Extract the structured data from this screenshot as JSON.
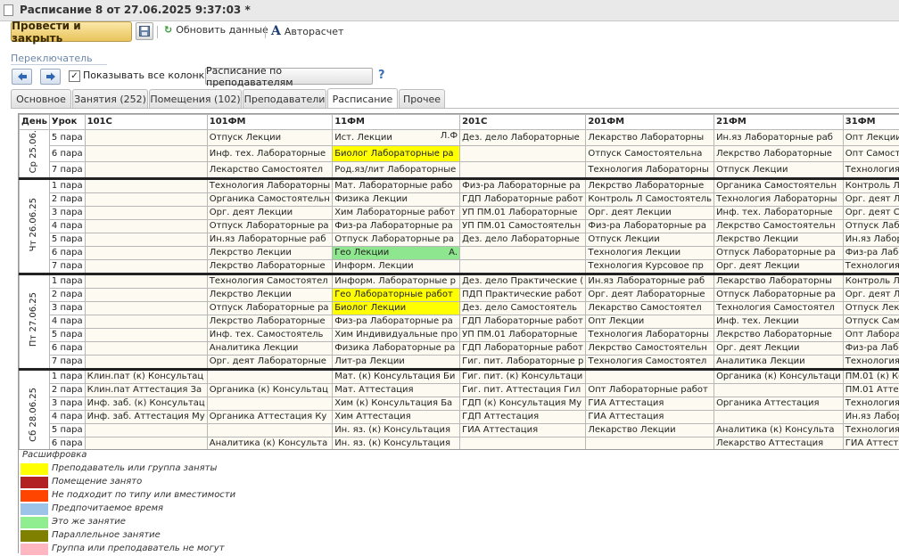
{
  "window": {
    "title": "Расписание 8 от 27.06.2025 9:37:03 *"
  },
  "toolbar": {
    "post_close": "Провести и закрыть",
    "refresh": "Обновить данные",
    "autocalc": "Авторасчет"
  },
  "switcher": {
    "label": "Переключатель",
    "show_all_columns": "Показывать все колонки",
    "show_all_checked": true,
    "by_teachers": "Расписание по преподавателям",
    "help": "?"
  },
  "tabs": [
    "Основное",
    "Занятия (252)",
    "Помещения (102)",
    "Преподаватели",
    "Расписание",
    "Прочее"
  ],
  "active_tab": "Расписание",
  "grid": {
    "headers": [
      "День",
      "Урок",
      "101С",
      "101ФМ",
      "11ФМ",
      "201С",
      "201ФМ",
      "21ФМ",
      "31ФМ"
    ],
    "days": [
      {
        "label": "Ср 25.06.",
        "rows": [
          {
            "lesson": "5 пара",
            "cells": [
              {
                "t": ""
              },
              {
                "t": "Отпуск Лекции"
              },
              {
                "t": "Ист. Лекции",
                "r": "Л.Ф"
              },
              {
                "t": "Дез. дело Лабораторные"
              },
              {
                "t": "Лекарство Лабораторны"
              },
              {
                "t": "Ин.яз Лабораторные раб"
              },
              {
                "t": "Опт Лекции",
                "r": "А.Х."
              }
            ]
          },
          {
            "lesson": "6 пара",
            "cells": [
              {
                "t": ""
              },
              {
                "t": "Инф. тех. Лабораторные"
              },
              {
                "t": "Биолог Лабораторные ра",
                "c": "y"
              },
              {
                "t": ""
              },
              {
                "t": "Отпуск Самостоятельна"
              },
              {
                "t": "Лекрство Лабораторные"
              },
              {
                "t": "Опт Самостоятельная на"
              }
            ]
          },
          {
            "lesson": "7 пара",
            "cells": [
              {
                "t": ""
              },
              {
                "t": "Лекарство Самостоятел"
              },
              {
                "t": "Род.яз/лит Лабораторные"
              },
              {
                "t": ""
              },
              {
                "t": "Технология Лабораторны"
              },
              {
                "t": "Отпуск Лекции"
              },
              {
                "t": "Технология Лекции"
              }
            ]
          }
        ]
      },
      {
        "label": "Чт 26.06.25",
        "rows": [
          {
            "lesson": "1 пара",
            "cells": [
              {
                "t": ""
              },
              {
                "t": "Технология Лабораторны"
              },
              {
                "t": "Мат. Лабораторные рабо"
              },
              {
                "t": "Физ-ра Лабораторные ра"
              },
              {
                "t": "Лекрство Лабораторные"
              },
              {
                "t": "Органика Самостоятельн"
              },
              {
                "t": "Контроль Л Лабораторны"
              }
            ]
          },
          {
            "lesson": "2 пара",
            "cells": [
              {
                "t": ""
              },
              {
                "t": "Органика Самостоятельн"
              },
              {
                "t": "Физика Лекции"
              },
              {
                "t": "ГДП Лабораторные работ"
              },
              {
                "t": "Контроль Л Самостоятель"
              },
              {
                "t": "Технология Лабораторны"
              },
              {
                "t": "Орг. деят Лекции"
              }
            ]
          },
          {
            "lesson": "3 пара",
            "cells": [
              {
                "t": ""
              },
              {
                "t": "Орг. деят Лекции"
              },
              {
                "t": "Хим Лабораторные работ"
              },
              {
                "t": "УП ПМ.01 Лабораторные"
              },
              {
                "t": "Орг. деят Лекции"
              },
              {
                "t": "Инф. тех. Лабораторные"
              },
              {
                "t": "Орг. деят Самостоятель"
              }
            ]
          },
          {
            "lesson": "4 пара",
            "cells": [
              {
                "t": ""
              },
              {
                "t": "Отпуск Лабораторные ра"
              },
              {
                "t": "Физ-ра Лабораторные ра"
              },
              {
                "t": "УП ПМ.01 Самостоятельн"
              },
              {
                "t": "Физ-ра Лабораторные ра"
              },
              {
                "t": "Лекрство Самостоятельн"
              },
              {
                "t": "Отпуск Лабораторные ра"
              }
            ]
          },
          {
            "lesson": "5 пара",
            "cells": [
              {
                "t": ""
              },
              {
                "t": "Ин.яз Лабораторные раб"
              },
              {
                "t": "Отпуск Лабораторные ра"
              },
              {
                "t": "Дез. дело Лабораторные"
              },
              {
                "t": "Отпуск Лекции"
              },
              {
                "t": "Лекрство Лекции"
              },
              {
                "t": "Ин.яз Лабораторные раб"
              }
            ]
          },
          {
            "lesson": "6 пара",
            "cells": [
              {
                "t": ""
              },
              {
                "t": "Лекрство Лекции"
              },
              {
                "t": "Гео Лекции",
                "r": "А.",
                "c": "g"
              },
              {
                "t": ""
              },
              {
                "t": "Технология Лекции"
              },
              {
                "t": "Отпуск Лабораторные ра"
              },
              {
                "t": "Физ-ра Лабораторные ра"
              }
            ]
          },
          {
            "lesson": "7 пара",
            "cells": [
              {
                "t": ""
              },
              {
                "t": "Лекрство Лабораторные"
              },
              {
                "t": "Информ. Лекции"
              },
              {
                "t": ""
              },
              {
                "t": "Технология Курсовое пр"
              },
              {
                "t": "Орг. деят Лекции"
              },
              {
                "t": "Технология Лабораторны"
              }
            ]
          }
        ]
      },
      {
        "label": "Пт 27.06.25",
        "rows": [
          {
            "lesson": "1 пара",
            "cells": [
              {
                "t": ""
              },
              {
                "t": "Технология Самостоятел"
              },
              {
                "t": "Информ. Лабораторные р"
              },
              {
                "t": "Дез. дело Практические ("
              },
              {
                "t": "Ин.яз Лабораторные раб"
              },
              {
                "t": "Лекарство Лабораторны"
              },
              {
                "t": "Контроль Л Лабораторны"
              }
            ]
          },
          {
            "lesson": "2 пара",
            "cells": [
              {
                "t": ""
              },
              {
                "t": "Лекрство Лекции"
              },
              {
                "t": "Гео Лабораторные работ",
                "c": "y"
              },
              {
                "t": "ПДП Практические работ"
              },
              {
                "t": "Орг. деят Лабораторные"
              },
              {
                "t": "Отпуск Лабораторные ра"
              },
              {
                "t": "Орг. деят Лабораторные"
              }
            ]
          },
          {
            "lesson": "3 пара",
            "cells": [
              {
                "t": ""
              },
              {
                "t": "Отпуск Лабораторные ра"
              },
              {
                "t": "Биолог Лекции",
                "c": "y"
              },
              {
                "t": "Дез. дело Самостоятель"
              },
              {
                "t": "Лекарство Самостоятел"
              },
              {
                "t": "Технология Самостоятел"
              },
              {
                "t": "Отпуск Лекции",
                "r": "А"
              }
            ]
          },
          {
            "lesson": "4 пара",
            "cells": [
              {
                "t": ""
              },
              {
                "t": "Лекрство Лабораторные"
              },
              {
                "t": "Физ-ра Лабораторные ра"
              },
              {
                "t": "ГДП Лабораторные работ"
              },
              {
                "t": "Опт Лекции"
              },
              {
                "t": "Инф. тех. Лекции"
              },
              {
                "t": "Отпуск Самостоятельна"
              }
            ]
          },
          {
            "lesson": "5 пара",
            "cells": [
              {
                "t": ""
              },
              {
                "t": "Инф. тех. Самостоятель"
              },
              {
                "t": "Хим Индивидуальные про"
              },
              {
                "t": "УП ПМ.01 Лабораторные"
              },
              {
                "t": "Технология Лабораторны"
              },
              {
                "t": "Лекрство Лабораторные"
              },
              {
                "t": "Опт Лабораторные работ"
              }
            ]
          },
          {
            "lesson": "6 пара",
            "cells": [
              {
                "t": ""
              },
              {
                "t": "Аналитика Лекции"
              },
              {
                "t": "Физика Лабораторные ра"
              },
              {
                "t": "ГДП Лабораторные работ"
              },
              {
                "t": "Лекрство Самостоятельн"
              },
              {
                "t": "Орг. деят Лекции"
              },
              {
                "t": "Физ-ра Лабораторные ра"
              }
            ]
          },
          {
            "lesson": "7 пара",
            "cells": [
              {
                "t": ""
              },
              {
                "t": "Орг. деят Лабораторные"
              },
              {
                "t": "Лит-ра Лекции"
              },
              {
                "t": "Гиг. пит. Лабораторные р"
              },
              {
                "t": "Технология Самостоятел"
              },
              {
                "t": "Аналитика Лекции"
              },
              {
                "t": "Технология Лабораторны"
              }
            ]
          }
        ]
      },
      {
        "label": "Сб 28.06.25",
        "rows": [
          {
            "lesson": "1 пара",
            "cells": [
              {
                "t": "Клин.пат (к) Консультац"
              },
              {
                "t": ""
              },
              {
                "t": "Мат. (к) Консультация Би"
              },
              {
                "t": "Гиг. пит. (к) Консультаци"
              },
              {
                "t": ""
              },
              {
                "t": "Органика (к) Консультаци"
              },
              {
                "t": "ПМ.01 (к) Консультация Ф"
              }
            ]
          },
          {
            "lesson": "2 пара",
            "cells": [
              {
                "t": "Клин.пат Аттестация За"
              },
              {
                "t": "Органика (к) Консультац"
              },
              {
                "t": "Мат. Аттестация"
              },
              {
                "t": "Гиг. пит. Аттестация Гил"
              },
              {
                "t": "Опт Лабораторные работ"
              },
              {
                "t": ""
              },
              {
                "t": "ПМ.01 Аттестация"
              }
            ]
          },
          {
            "lesson": "3 пара",
            "cells": [
              {
                "t": "Инф. заб. (к) Консультац"
              },
              {
                "t": ""
              },
              {
                "t": "Хим (к) Консультация Ба"
              },
              {
                "t": "ГДП (к) Консультация Му"
              },
              {
                "t": "ГИА Аттестация"
              },
              {
                "t": "Органика Аттестация"
              },
              {
                "t": "Технология Курсовое про"
              }
            ]
          },
          {
            "lesson": "4 пара",
            "cells": [
              {
                "t": "Инф. заб. Аттестация Му"
              },
              {
                "t": "Органика Аттестация Ку"
              },
              {
                "t": "Хим Аттестация"
              },
              {
                "t": "ГДП Аттестация"
              },
              {
                "t": "ГИА Аттестация"
              },
              {
                "t": ""
              },
              {
                "t": "Ин.яз Лабораторные раб"
              }
            ]
          },
          {
            "lesson": "5 пара",
            "cells": [
              {
                "t": ""
              },
              {
                "t": ""
              },
              {
                "t": "Ин. яз. (к) Консультация"
              },
              {
                "t": "ГИА Аттестация"
              },
              {
                "t": "Лекарство Лекции"
              },
              {
                "t": "Аналитика (к) Консульта"
              },
              {
                "t": "Технология Самостоятел"
              }
            ]
          },
          {
            "lesson": "6 пара",
            "cells": [
              {
                "t": ""
              },
              {
                "t": "Аналитика (к) Консульта"
              },
              {
                "t": "Ин. яз. (к) Консультация"
              },
              {
                "t": ""
              },
              {
                "t": ""
              },
              {
                "t": "Лекарство Аттестация"
              },
              {
                "t": "ГИА Аттестация"
              }
            ]
          },
          {
            "lesson": "7 пара",
            "cells": [
              {
                "t": ""
              },
              {
                "t": "Лекрство Самостоятель"
              },
              {
                "t": "Ин. яз. Аттестация"
              },
              {
                "t": ""
              },
              {
                "t": ""
              },
              {
                "t": "Аналитика Аттестация К"
              },
              {
                "t": "ГИА Аттестация"
              }
            ]
          }
        ]
      }
    ]
  },
  "legend": {
    "title": "Расшифровка",
    "items": [
      {
        "color": "#ffff00",
        "label": "Преподаватель или группа заняты"
      },
      {
        "color": "#b22222",
        "label": "Помещение занято"
      },
      {
        "color": "#ff4500",
        "label": "Не подходит по типу или вместимости"
      },
      {
        "color": "#9cc3e8",
        "label": "Предпочитаемое время"
      },
      {
        "color": "#90ee90",
        "label": "Это же занятие"
      },
      {
        "color": "#808000",
        "label": "Параллельное занятие"
      },
      {
        "color": "#ffb6c1",
        "label": "Группа или преподаватель не могут"
      }
    ]
  }
}
